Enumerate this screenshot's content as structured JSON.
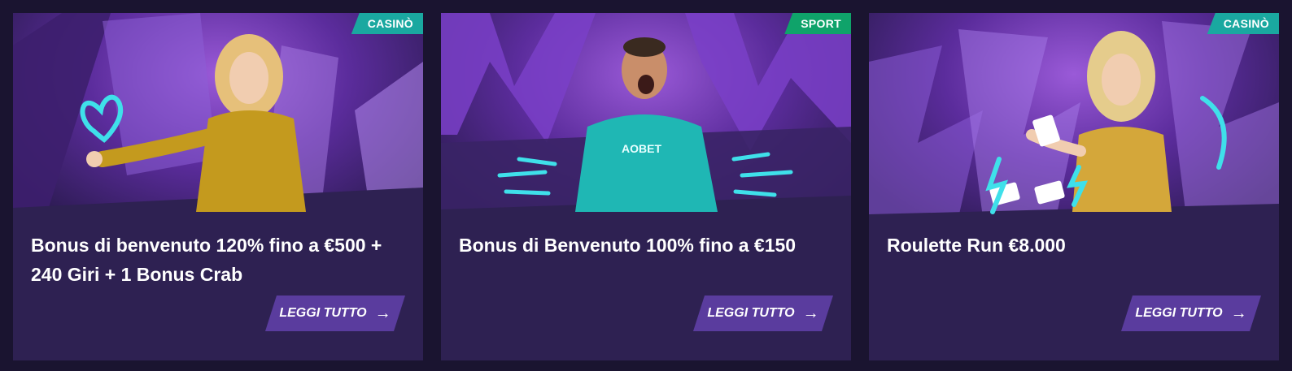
{
  "promotions": [
    {
      "badge": "CASINÒ",
      "badge_color": "#1aa8a0",
      "title": "Bonus di benvenuto 120% fino a €500 + 240 Giri + 1 Bonus Crab",
      "cta": "LEGGI TUTTO",
      "cta_icon": "arrow-right-icon"
    },
    {
      "badge": "SPORT",
      "badge_color": "#0fa36a",
      "title": "Bonus di Benvenuto 100% fino a €150",
      "cta": "LEGGI TUTTO",
      "cta_icon": "arrow-right-icon",
      "shirt_text": "AOBET"
    },
    {
      "badge": "CASINÒ",
      "badge_color": "#1aa8a0",
      "title": "Roulette Run €8.000",
      "cta": "LEGGI TUTTO",
      "cta_icon": "arrow-right-icon"
    }
  ],
  "colors": {
    "page_bg": "#1a1430",
    "card_bg": "#2e2152",
    "cta_bg": "#5a3c9e",
    "accent_cyan": "#3fe0ea"
  }
}
